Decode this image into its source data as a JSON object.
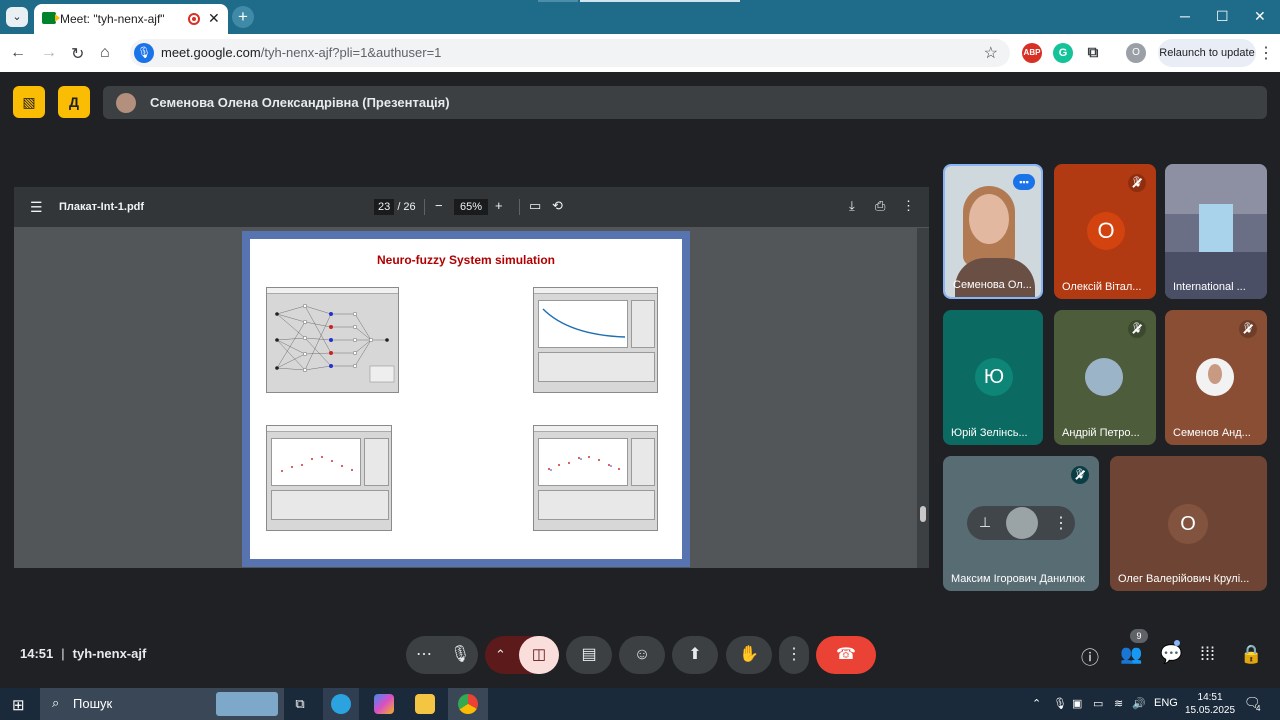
{
  "browser": {
    "tab_title": "Meet: \"tyh-nenx-ajf\"",
    "tab_list_icon": "chevron-down-icon",
    "new_tab_label": "+",
    "url_host": "meet.google.com",
    "url_path": "/tyh-nenx-ajf?pli=1&authuser=1",
    "relaunch_label": "Relaunch to update",
    "profile_initial": "O",
    "ext_abp": "ABP",
    "ext_grammarly": "G"
  },
  "meet": {
    "presenter_bar_title": "Семенова Олена Олександрівна (Презентація)",
    "meeting_time": "14:51",
    "meeting_code": "tyh-nenx-ajf",
    "participants_badge": "9"
  },
  "pdf_viewer": {
    "filename": "Плакат-Int-1.pdf",
    "current_page": "23",
    "total_pages": "/ 26",
    "zoom": "65%",
    "page_heading": "Neuro-fuzzy System simulation"
  },
  "participants": [
    {
      "name": "Семенова Ол...",
      "type": "video"
    },
    {
      "name": "Олексій Вітал...",
      "initial": "О",
      "muted": true,
      "color": "#b23a12"
    },
    {
      "name": "International ...",
      "type": "video"
    },
    {
      "name": "Юрій Зелінсь...",
      "initial": "Ю",
      "color": "#0b6b63"
    },
    {
      "name": "Андрій Петро...",
      "muted": true,
      "color": "#4d5c3a"
    },
    {
      "name": "Семенов Анд...",
      "muted": true,
      "color": "#8a4e35"
    },
    {
      "name": "Максим Ігорович Данилюк",
      "muted": true,
      "color": "#586c74"
    },
    {
      "name": "Олег Валерійович Крулі...",
      "initial": "О",
      "color": "#6e4534"
    }
  ],
  "taskbar": {
    "search_placeholder": "Пошук",
    "language": "ENG",
    "time": "14:51",
    "date": "15.05.2025",
    "notification_count": "4"
  }
}
